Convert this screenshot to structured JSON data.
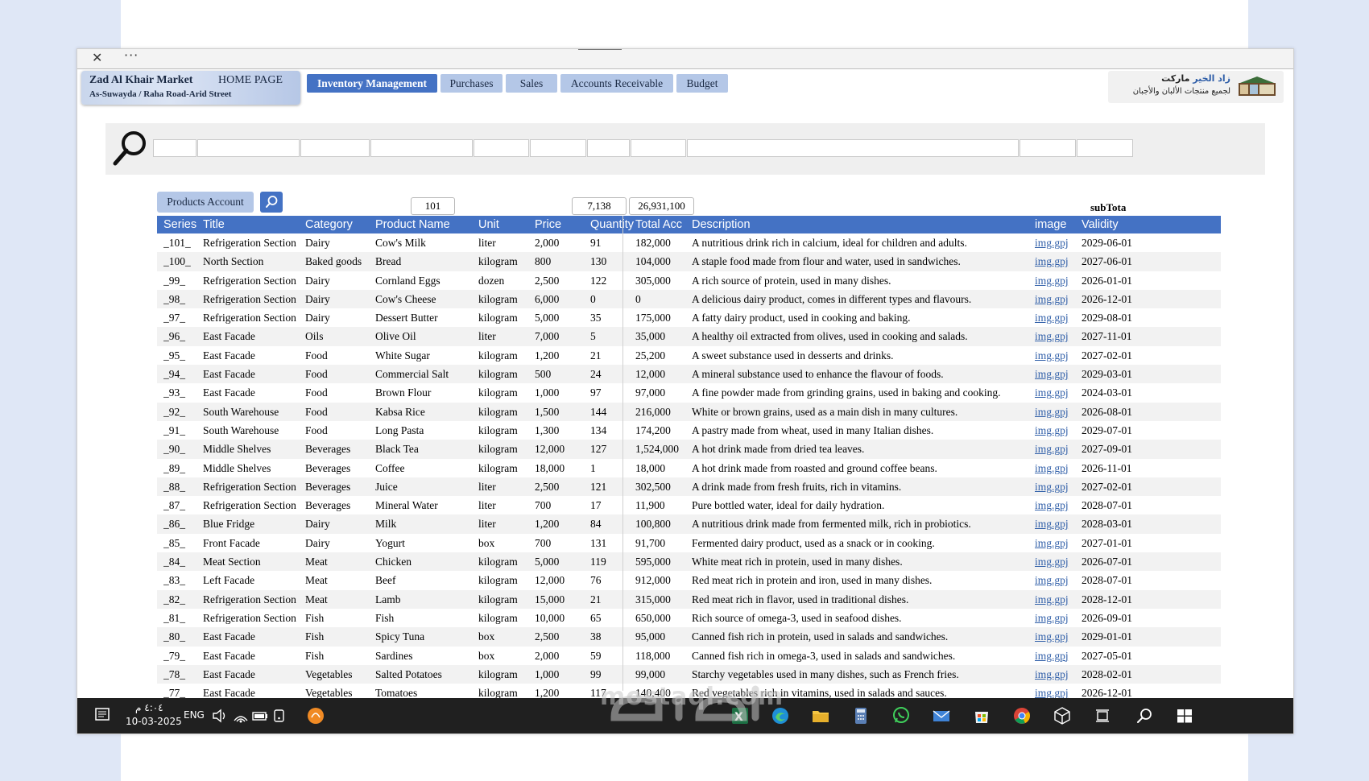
{
  "window": {
    "close_label": "✕",
    "more_label": "···"
  },
  "header": {
    "market_name": "Zad Al Khair Market",
    "home_label": "HOME PAGE",
    "address": "As-Suwayda / Raha Road-Arid Street",
    "logo_line1_blue": "زاد الخير",
    "logo_line1": " ماركت",
    "logo_line2": "لجميع منتجات الألبان والأجبان"
  },
  "nav": {
    "inventory": "Inventory Management",
    "purchases": "Purchases",
    "sales": "Sales",
    "receivable": "Accounts Receivable",
    "budget": "Budget"
  },
  "toolbar": {
    "products_account": "Products Account",
    "count": "101",
    "quantity_total": "7,138",
    "amount_total": "26,931,100",
    "subtotal_label": "subTota"
  },
  "table": {
    "headers": [
      "Series",
      "Title",
      "Category",
      "Product Name",
      "Unit",
      "Price",
      "Quantity",
      "Total Acc",
      "Description",
      "image",
      "Validity"
    ],
    "rows": [
      [
        "_101_",
        "Refrigeration Section",
        "Dairy",
        "Cow's Milk",
        "liter",
        "2,000",
        "91",
        "182,000",
        "A nutritious drink rich in calcium, ideal for children and adults.",
        "img.gpj",
        "2029-06-01"
      ],
      [
        "_100_",
        "North Section",
        "Baked goods",
        "Bread",
        "kilogram",
        "800",
        "130",
        "104,000",
        "A staple food made from flour and water, used in sandwiches.",
        "img.gpj",
        "2027-06-01"
      ],
      [
        "_99_",
        "Refrigeration Section",
        "Dairy",
        "Cornland Eggs",
        "dozen",
        "2,500",
        "122",
        "305,000",
        "A rich source of protein, used in many dishes.",
        "img.gpj",
        "2026-01-01"
      ],
      [
        "_98_",
        "Refrigeration Section",
        "Dairy",
        "Cow's Cheese",
        "kilogram",
        "6,000",
        "0",
        "0",
        "A delicious dairy product, comes in different types and flavours.",
        "img.gpj",
        "2026-12-01"
      ],
      [
        "_97_",
        "Refrigeration Section",
        "Dairy",
        "Dessert Butter",
        "kilogram",
        "5,000",
        "35",
        "175,000",
        "A fatty dairy product, used in cooking and baking.",
        "img.gpj",
        "2029-08-01"
      ],
      [
        "_96_",
        "East Facade",
        "Oils",
        "Olive Oil",
        "liter",
        "7,000",
        "5",
        "35,000",
        "A healthy oil extracted from olives, used in cooking and salads.",
        "img.gpj",
        "2027-11-01"
      ],
      [
        "_95_",
        "East Facade",
        "Food",
        "White Sugar",
        "kilogram",
        "1,200",
        "21",
        "25,200",
        "A sweet substance used in desserts and drinks.",
        "img.gpj",
        "2027-02-01"
      ],
      [
        "_94_",
        "East Facade",
        "Food",
        "Commercial Salt",
        "kilogram",
        "500",
        "24",
        "12,000",
        "A mineral substance used to enhance the flavour of foods.",
        "img.gpj",
        "2029-03-01"
      ],
      [
        "_93_",
        "East Facade",
        "Food",
        "Brown Flour",
        "kilogram",
        "1,000",
        "97",
        "97,000",
        "A fine powder made from grinding grains, used in baking and cooking.",
        "img.gpj",
        "2024-03-01"
      ],
      [
        "_92_",
        "South Warehouse",
        "Food",
        "Kabsa Rice",
        "kilogram",
        "1,500",
        "144",
        "216,000",
        "White or brown grains, used as a main dish in many cultures.",
        "img.gpj",
        "2026-08-01"
      ],
      [
        "_91_",
        "South Warehouse",
        "Food",
        "Long Pasta",
        "kilogram",
        "1,300",
        "134",
        "174,200",
        "A pastry made from wheat, used in many Italian dishes.",
        "img.gpj",
        "2029-07-01"
      ],
      [
        "_90_",
        "Middle Shelves",
        "Beverages",
        "Black Tea",
        "kilogram",
        "12,000",
        "127",
        "1,524,000",
        "A hot drink made from dried tea leaves.",
        "img.gpj",
        "2027-09-01"
      ],
      [
        "_89_",
        "Middle Shelves",
        "Beverages",
        "Coffee",
        "kilogram",
        "18,000",
        "1",
        "18,000",
        "A hot drink made from roasted and ground coffee beans.",
        "img.gpj",
        "2026-11-01"
      ],
      [
        "_88_",
        "Refrigeration Section",
        "Beverages",
        "Juice",
        "liter",
        "2,500",
        "121",
        "302,500",
        "A drink made from fresh fruits, rich in vitamins.",
        "img.gpj",
        "2027-02-01"
      ],
      [
        "_87_",
        "Refrigeration Section",
        "Beverages",
        "Mineral Water",
        "liter",
        "700",
        "17",
        "11,900",
        "Pure bottled water, ideal for daily hydration.",
        "img.gpj",
        "2028-07-01"
      ],
      [
        "_86_",
        "Blue Fridge",
        "Dairy",
        "Milk",
        "liter",
        "1,200",
        "84",
        "100,800",
        "A nutritious drink made from fermented milk, rich in probiotics.",
        "img.gpj",
        "2028-03-01"
      ],
      [
        "_85_",
        "Front Facade",
        "Dairy",
        "Yogurt",
        "box",
        "700",
        "131",
        "91,700",
        "Fermented dairy product, used as a snack or in cooking.",
        "img.gpj",
        "2027-01-01"
      ],
      [
        "_84_",
        "Meat Section",
        "Meat",
        "Chicken",
        "kilogram",
        "5,000",
        "119",
        "595,000",
        "White meat rich in protein, used in many dishes.",
        "img.gpj",
        "2026-07-01"
      ],
      [
        "_83_",
        "Left Facade",
        "Meat",
        "Beef",
        "kilogram",
        "12,000",
        "76",
        "912,000",
        "Red meat rich in protein and iron, used in many dishes.",
        "img.gpj",
        "2028-07-01"
      ],
      [
        "_82_",
        "Refrigeration Section",
        "Meat",
        "Lamb",
        "kilogram",
        "15,000",
        "21",
        "315,000",
        "Red meat rich in flavor, used in traditional dishes.",
        "img.gpj",
        "2028-12-01"
      ],
      [
        "_81_",
        "Refrigeration Section",
        "Fish",
        "Fish",
        "kilogram",
        "10,000",
        "65",
        "650,000",
        "Rich source of omega-3, used in seafood dishes.",
        "img.gpj",
        "2026-09-01"
      ],
      [
        "_80_",
        "East Facade",
        "Fish",
        "Spicy Tuna",
        "box",
        "2,500",
        "38",
        "95,000",
        "Canned fish rich in protein, used in salads and sandwiches.",
        "img.gpj",
        "2029-01-01"
      ],
      [
        "_79_",
        "East Facade",
        "Fish",
        "Sardines",
        "box",
        "2,000",
        "59",
        "118,000",
        "Canned fish rich in omega-3, used in salads and sandwiches.",
        "img.gpj",
        "2027-05-01"
      ],
      [
        "_78_",
        "East Facade",
        "Vegetables",
        "Salted Potatoes",
        "kilogram",
        "1,000",
        "99",
        "99,000",
        "Starchy vegetables used in many dishes, such as French fries.",
        "img.gpj",
        "2028-02-01"
      ],
      [
        "_77_",
        "East Facade",
        "Vegetables",
        "Tomatoes",
        "kilogram",
        "1,200",
        "117",
        "140,400",
        "Red vegetables rich in vitamins, used in salads and sauces.",
        "img.gpj",
        "2026-12-01"
      ]
    ]
  },
  "taskbar": {
    "time": "٤:٠٤ م",
    "date": "10-03-2025",
    "language": "ENG"
  },
  "watermark": {
    "text": "mostaql.com"
  },
  "colors": {
    "header_blue": "#4472c4",
    "tab_light": "#b4c7e7",
    "taskbar": "#202020",
    "link": "#2f5ea8"
  },
  "icons": [
    "close-icon",
    "more-icon",
    "search-icon",
    "notification-icon",
    "volume-icon",
    "wifi-icon",
    "battery-icon",
    "excel-icon",
    "edge-icon",
    "folder-icon",
    "calculator-icon",
    "whatsapp-icon",
    "mail-icon",
    "store-icon",
    "chrome-icon",
    "box-icon",
    "task-view-icon",
    "windows-icon"
  ]
}
